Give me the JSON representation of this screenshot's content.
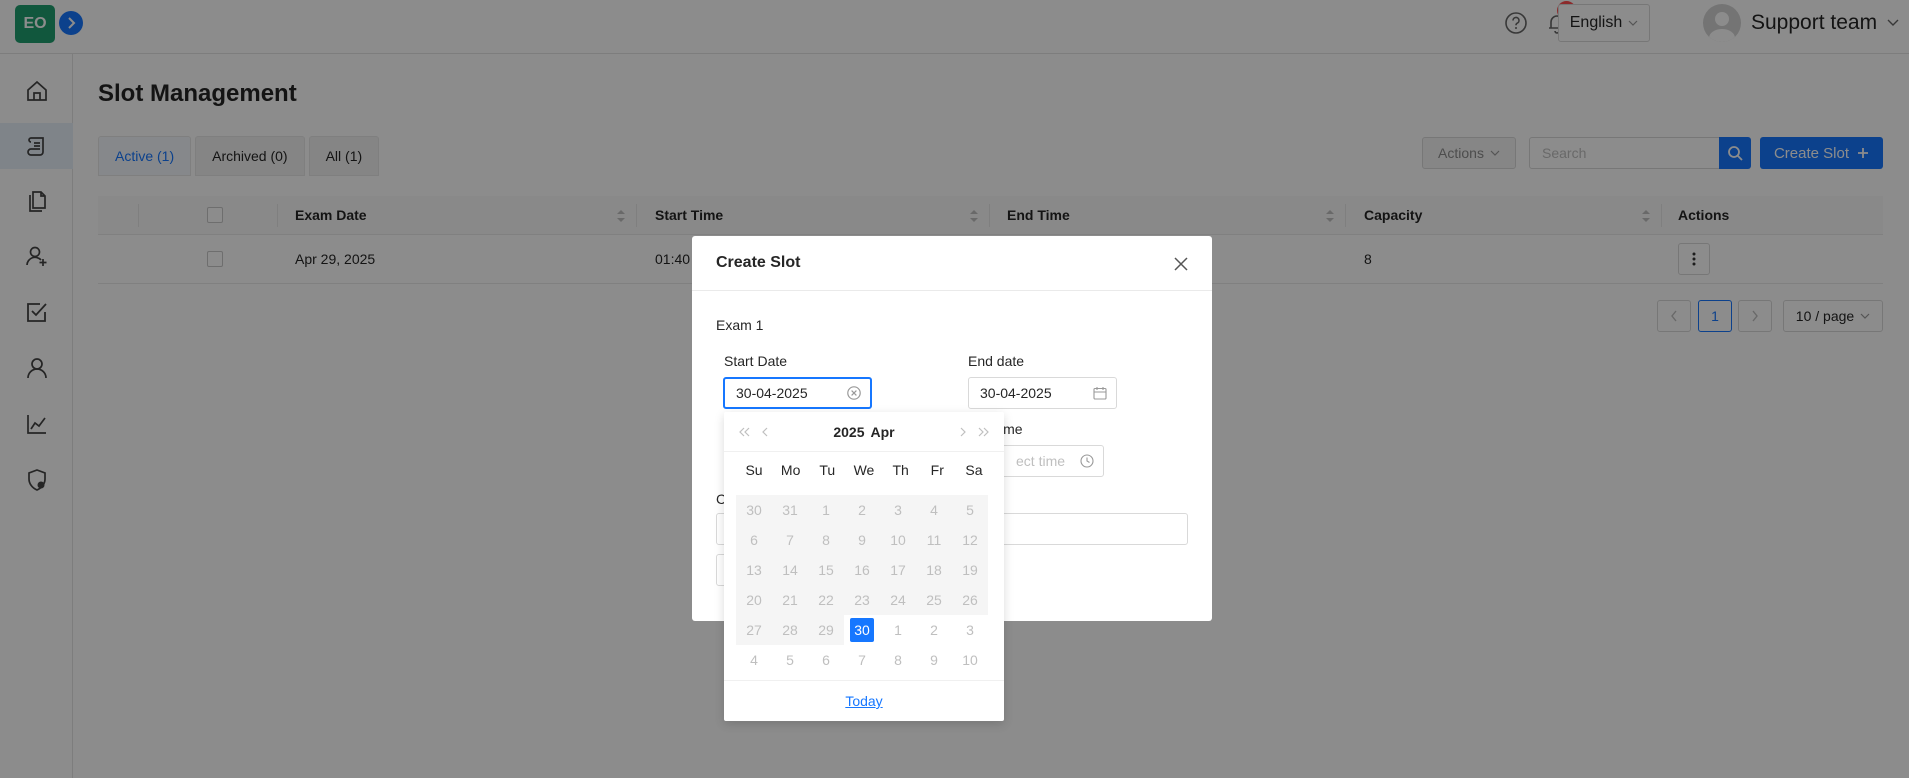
{
  "topbar": {
    "logo_text": "EO",
    "notification_count": "0",
    "language": "English",
    "user_name": "Support team"
  },
  "page": {
    "title": "Slot Management",
    "tabs": [
      {
        "label": "Active (1)",
        "active": true
      },
      {
        "label": "Archived (0)",
        "active": false
      },
      {
        "label": "All (1)",
        "active": false
      }
    ],
    "actions_label": "Actions",
    "search_placeholder": "Search",
    "create_label": "Create Slot"
  },
  "table": {
    "columns": [
      "Exam Date",
      "Start Time",
      "End Time",
      "Capacity",
      "Actions"
    ],
    "rows": [
      {
        "exam_date": "Apr 29, 2025",
        "start_time": "01:40",
        "capacity": "8"
      }
    ]
  },
  "pagination": {
    "current_page": "1",
    "page_size": "10 / page"
  },
  "modal": {
    "title": "Create Slot",
    "exam_name": "Exam 1",
    "start_date_label": "Start Date",
    "start_date_value": "30-04-2025",
    "end_date_label": "End date",
    "end_date_value": "30-04-2025",
    "time_label_partial": "ime",
    "time_placeholder_partial": "ect time",
    "hidden_label_partial": "C"
  },
  "datepicker": {
    "year": "2025",
    "month": "Apr",
    "weekdays": [
      "Su",
      "Mo",
      "Tu",
      "We",
      "Th",
      "Fr",
      "Sa"
    ],
    "weeks": [
      [
        "30",
        "31",
        "1",
        "2",
        "3",
        "4",
        "5"
      ],
      [
        "6",
        "7",
        "8",
        "9",
        "10",
        "11",
        "12"
      ],
      [
        "13",
        "14",
        "15",
        "16",
        "17",
        "18",
        "19"
      ],
      [
        "20",
        "21",
        "22",
        "23",
        "24",
        "25",
        "26"
      ],
      [
        "27",
        "28",
        "29",
        "30",
        "1",
        "2",
        "3"
      ],
      [
        "4",
        "5",
        "6",
        "7",
        "8",
        "9",
        "10"
      ]
    ],
    "selected_day": "30",
    "today_label": "Today"
  },
  "colors": {
    "primary": "#1677ff",
    "brand": "#1f9e6f",
    "badge": "#ff4d4f"
  }
}
